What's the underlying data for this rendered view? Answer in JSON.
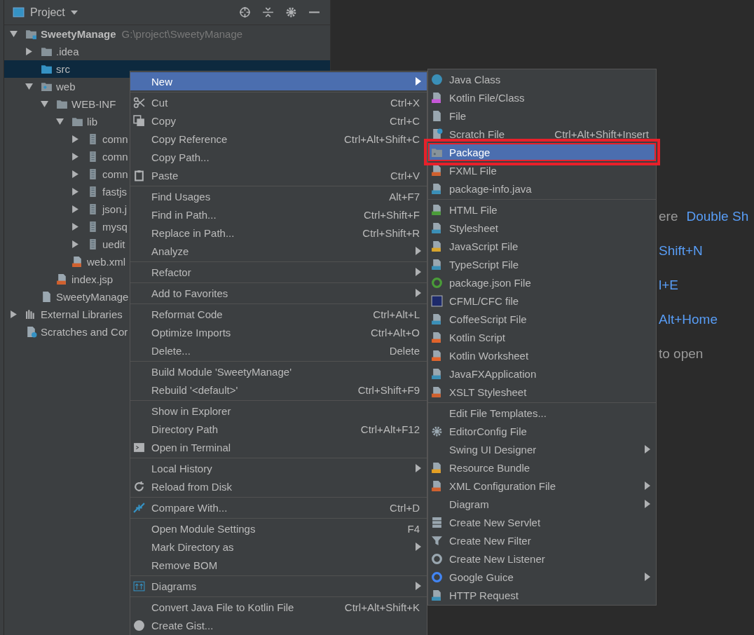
{
  "project_panel": {
    "title": "Project",
    "tree": [
      {
        "label": "SweetyManage",
        "path": "G:\\project\\SweetyManage",
        "kind": "module",
        "expanded": true,
        "selected": false,
        "children": [
          {
            "label": ".idea",
            "kind": "folder",
            "expanded": false,
            "selected": false
          },
          {
            "label": "src",
            "kind": "source",
            "selected": true
          },
          {
            "label": "web",
            "kind": "web",
            "expanded": true,
            "selected": false,
            "children": [
              {
                "label": "WEB-INF",
                "kind": "folder",
                "expanded": true,
                "selected": false,
                "children": [
                  {
                    "label": "lib",
                    "kind": "folder",
                    "expanded": true,
                    "selected": false,
                    "children": [
                      {
                        "label": "comn",
                        "kind": "jar",
                        "expanded": false,
                        "selected": false
                      },
                      {
                        "label": "comn",
                        "kind": "jar",
                        "expanded": false,
                        "selected": false
                      },
                      {
                        "label": "comn",
                        "kind": "jar",
                        "expanded": false,
                        "selected": false
                      },
                      {
                        "label": "fastjs",
                        "kind": "jar",
                        "expanded": false,
                        "selected": false
                      },
                      {
                        "label": "json.j",
                        "kind": "jar",
                        "expanded": false,
                        "selected": false
                      },
                      {
                        "label": "mysq",
                        "kind": "jar",
                        "expanded": false,
                        "selected": false
                      },
                      {
                        "label": "uedit",
                        "kind": "jar",
                        "expanded": false,
                        "selected": false
                      }
                    ]
                  },
                  {
                    "label": "web.xml",
                    "kind": "xml",
                    "selected": false
                  }
                ]
              },
              {
                "label": "index.jsp",
                "kind": "jsp",
                "selected": false
              }
            ]
          },
          {
            "label": "SweetyManage",
            "kind": "iml",
            "selected": false
          }
        ]
      },
      {
        "label": "External Libraries",
        "kind": "libraries",
        "expanded": false,
        "selected": false
      },
      {
        "label": "Scratches and Cor",
        "kind": "scratches",
        "selected": false
      }
    ]
  },
  "context_menu": {
    "groups": [
      [
        {
          "label": "New",
          "selected": true,
          "submenu": true
        }
      ],
      [
        {
          "label": "Cut",
          "shortcut": "Ctrl+X",
          "selected": false,
          "submenu": false
        },
        {
          "label": "Copy",
          "shortcut": "Ctrl+C",
          "selected": false,
          "submenu": false
        },
        {
          "label": "Copy Reference",
          "shortcut": "Ctrl+Alt+Shift+C",
          "selected": false,
          "submenu": false
        },
        {
          "label": "Copy Path...",
          "selected": false,
          "submenu": false
        },
        {
          "label": "Paste",
          "shortcut": "Ctrl+V",
          "selected": false,
          "submenu": false
        }
      ],
      [
        {
          "label": "Find Usages",
          "shortcut": "Alt+F7",
          "selected": false,
          "submenu": false
        },
        {
          "label": "Find in Path...",
          "shortcut": "Ctrl+Shift+F",
          "selected": false,
          "submenu": false
        },
        {
          "label": "Replace in Path...",
          "shortcut": "Ctrl+Shift+R",
          "selected": false,
          "submenu": false
        },
        {
          "label": "Analyze",
          "selected": false,
          "submenu": true
        }
      ],
      [
        {
          "label": "Refactor",
          "selected": false,
          "submenu": true
        }
      ],
      [
        {
          "label": "Add to Favorites",
          "selected": false,
          "submenu": true
        }
      ],
      [
        {
          "label": "Reformat Code",
          "shortcut": "Ctrl+Alt+L",
          "selected": false,
          "submenu": false
        },
        {
          "label": "Optimize Imports",
          "shortcut": "Ctrl+Alt+O",
          "selected": false,
          "submenu": false
        },
        {
          "label": "Delete...",
          "shortcut": "Delete",
          "selected": false,
          "submenu": false
        }
      ],
      [
        {
          "label": "Build Module 'SweetyManage'",
          "selected": false,
          "submenu": false
        },
        {
          "label": "Rebuild '<default>'",
          "shortcut": "Ctrl+Shift+F9",
          "selected": false,
          "submenu": false
        }
      ],
      [
        {
          "label": "Show in Explorer",
          "selected": false,
          "submenu": false
        },
        {
          "label": "Directory Path",
          "shortcut": "Ctrl+Alt+F12",
          "selected": false,
          "submenu": false
        },
        {
          "label": "Open in Terminal",
          "selected": false,
          "submenu": false
        }
      ],
      [
        {
          "label": "Local History",
          "selected": false,
          "submenu": true
        },
        {
          "label": "Reload from Disk",
          "selected": false,
          "submenu": false
        }
      ],
      [
        {
          "label": "Compare With...",
          "shortcut": "Ctrl+D",
          "selected": false,
          "submenu": false
        }
      ],
      [
        {
          "label": "Open Module Settings",
          "shortcut": "F4",
          "selected": false,
          "submenu": false
        },
        {
          "label": "Mark Directory as",
          "selected": false,
          "submenu": true
        },
        {
          "label": "Remove BOM",
          "selected": false,
          "submenu": false
        }
      ],
      [
        {
          "label": "Diagrams",
          "selected": false,
          "submenu": true
        }
      ],
      [
        {
          "label": "Convert Java File to Kotlin File",
          "shortcut": "Ctrl+Alt+Shift+K",
          "selected": false,
          "submenu": false
        },
        {
          "label": "Create Gist...",
          "selected": false,
          "submenu": false
        }
      ]
    ]
  },
  "new_submenu": {
    "groups": [
      [
        {
          "label": "Java Class",
          "selected": false,
          "submenu": false
        },
        {
          "label": "Kotlin File/Class",
          "selected": false,
          "submenu": false
        },
        {
          "label": "File",
          "selected": false,
          "submenu": false
        },
        {
          "label": "Scratch File",
          "shortcut": "Ctrl+Alt+Shift+Insert",
          "selected": false,
          "submenu": false
        },
        {
          "label": "Package",
          "selected": true,
          "submenu": false,
          "annotated": true
        },
        {
          "label": "FXML File",
          "selected": false,
          "submenu": false
        },
        {
          "label": "package-info.java",
          "selected": false,
          "submenu": false
        }
      ],
      [
        {
          "label": "HTML File",
          "selected": false,
          "submenu": false
        },
        {
          "label": "Stylesheet",
          "selected": false,
          "submenu": false
        },
        {
          "label": "JavaScript File",
          "selected": false,
          "submenu": false
        },
        {
          "label": "TypeScript File",
          "selected": false,
          "submenu": false
        },
        {
          "label": "package.json File",
          "selected": false,
          "submenu": false
        },
        {
          "label": "CFML/CFC file",
          "selected": false,
          "submenu": false
        },
        {
          "label": "CoffeeScript File",
          "selected": false,
          "submenu": false
        },
        {
          "label": "Kotlin Script",
          "selected": false,
          "submenu": false
        },
        {
          "label": "Kotlin Worksheet",
          "selected": false,
          "submenu": false
        },
        {
          "label": "JavaFXApplication",
          "selected": false,
          "submenu": false
        },
        {
          "label": "XSLT Stylesheet",
          "selected": false,
          "submenu": false
        }
      ],
      [
        {
          "label": "Edit File Templates...",
          "selected": false,
          "submenu": false
        },
        {
          "label": "EditorConfig File",
          "selected": false,
          "submenu": false
        },
        {
          "label": "Swing UI Designer",
          "selected": false,
          "submenu": true
        },
        {
          "label": "Resource Bundle",
          "selected": false,
          "submenu": false
        },
        {
          "label": "XML Configuration File",
          "selected": false,
          "submenu": true
        },
        {
          "label": "Diagram",
          "selected": false,
          "submenu": true
        },
        {
          "label": "Create New Servlet",
          "selected": false,
          "submenu": false
        },
        {
          "label": "Create New Filter",
          "selected": false,
          "submenu": false
        },
        {
          "label": "Create New Listener",
          "selected": false,
          "submenu": false
        },
        {
          "label": "Google Guice",
          "selected": false,
          "submenu": true
        },
        {
          "label": "HTTP Request",
          "selected": false,
          "submenu": false
        }
      ]
    ]
  },
  "editor_hints": [
    {
      "label": "ere",
      "shortcut": "Double Sh"
    },
    {
      "shortcut": "Shift+N"
    },
    {
      "shortcut": "l+E"
    },
    {
      "shortcut": "Alt+Home"
    },
    {
      "label": "to open"
    }
  ]
}
